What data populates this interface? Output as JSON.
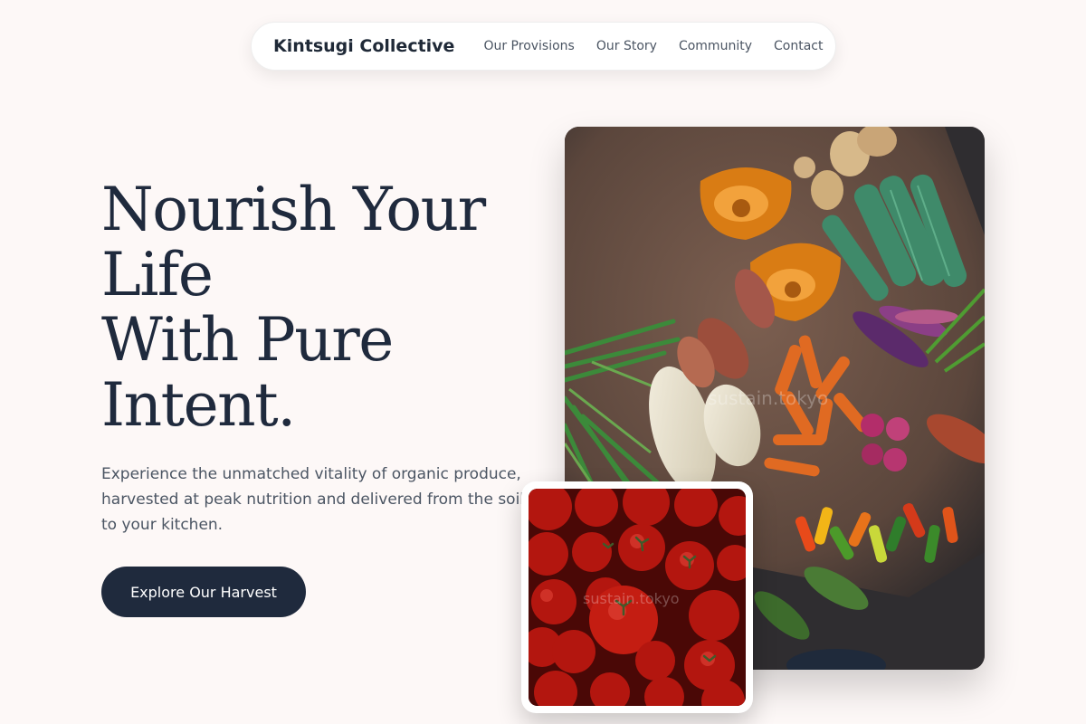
{
  "nav": {
    "brand": "Kintsugi Collective",
    "links": [
      "Our Provisions",
      "Our Story",
      "Community",
      "Contact"
    ]
  },
  "hero": {
    "title_lines": [
      "Nourish Your",
      "Life",
      "With Pure",
      "Intent."
    ],
    "subtitle": "Experience the unmatched vitality of organic produce, harvested at peak nutrition and delivered from the soil to your kitchen.",
    "cta_label": "Explore Our Harvest"
  },
  "images": {
    "main_watermark": "sustain.tokyo",
    "tomato_watermark": "sustain.tokyo"
  },
  "colors": {
    "background": "#fdf8f7",
    "primary": "#1f2a3d",
    "text_muted": "#4b5563"
  }
}
